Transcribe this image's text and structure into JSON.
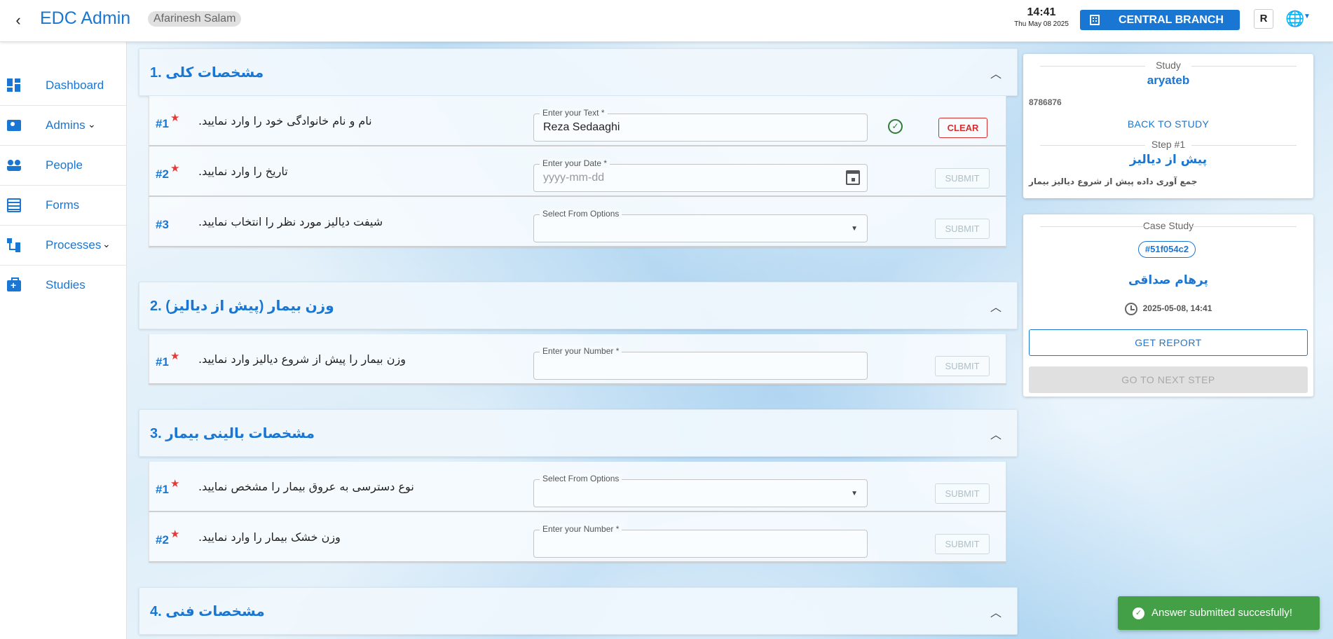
{
  "header": {
    "back_icon": "chevron-left-icon",
    "app_title": "EDC Admin",
    "user": "Afarinesh Salam",
    "time": "14:41",
    "date": "Thu May 08 2025",
    "branch": "CENTRAL BRANCH",
    "branch_icon": "building-icon",
    "r_label": "R",
    "language_icon": "globe-icon",
    "accent_color": "#1976d2"
  },
  "sidebar": {
    "items": [
      {
        "label": "Dashboard",
        "icon": "dashboard-icon"
      },
      {
        "label": "Admins",
        "icon": "admin-icon",
        "expandable": true
      },
      {
        "label": "People",
        "icon": "people-icon"
      },
      {
        "label": "Forms",
        "icon": "forms-icon"
      },
      {
        "label": "Processes",
        "icon": "processes-icon",
        "expandable": true
      },
      {
        "label": "Studies",
        "icon": "studies-icon"
      }
    ]
  },
  "sections": [
    {
      "title": "1. مشخصات کلی",
      "questions": [
        {
          "num": "#1",
          "required": true,
          "text": ".نام و نام خانوادگی خود را وارد نمایید",
          "field_label": "Enter your Text *",
          "value": "Reza Sedaaghi",
          "answered": true,
          "clear_label": "CLEAR"
        },
        {
          "num": "#2",
          "required": true,
          "text": ".تاریخ را وارد نمایید",
          "field_label": "Enter your Date *",
          "placeholder": "yyyy-mm-dd",
          "submit_label": "SUBMIT"
        },
        {
          "num": "#3",
          "required": false,
          "text": ".شیفت دیالیز مورد نظر را انتخاب نمایید",
          "field_label": "Select From Options",
          "submit_label": "SUBMIT"
        }
      ]
    },
    {
      "title": "2. وزن بیمار (پیش از دیالیز)",
      "questions": [
        {
          "num": "#1",
          "required": true,
          "text": ".وزن بیمار را پیش از شروع دیالیز وارد نمایید",
          "field_label": "Enter your Number *",
          "submit_label": "SUBMIT"
        }
      ]
    },
    {
      "title": "3. مشخصات بالینی بیمار",
      "questions": [
        {
          "num": "#1",
          "required": true,
          "text": ".نوع دسترسی به عروق بیمار را مشخص نمایید",
          "field_label": "Select From Options",
          "submit_label": "SUBMIT"
        },
        {
          "num": "#2",
          "required": true,
          "text": ".وزن خشک بیمار را وارد نمایید",
          "field_label": "Enter your Number *",
          "submit_label": "SUBMIT"
        }
      ]
    },
    {
      "title": "4. مشخصات فنی",
      "questions": []
    }
  ],
  "study_panel": {
    "study_label": "Study",
    "study_name": "aryateb",
    "study_id": "8786876",
    "back_label": "BACK TO STUDY",
    "step_label": "Step #1",
    "step_name": "پیش از دیالیز",
    "step_desc": "جمع آوری داده پیش از شروع دیالیز بیمار"
  },
  "case_panel": {
    "label": "Case Study",
    "case_id": "#51f054c2",
    "patient": "پرهام صداقی",
    "datetime": "2025-05-08, 14:41",
    "report_label": "GET REPORT",
    "next_label": "GO TO NEXT STEP"
  },
  "toast": {
    "message": "Answer submitted succesfully!",
    "color": "#43a047"
  }
}
